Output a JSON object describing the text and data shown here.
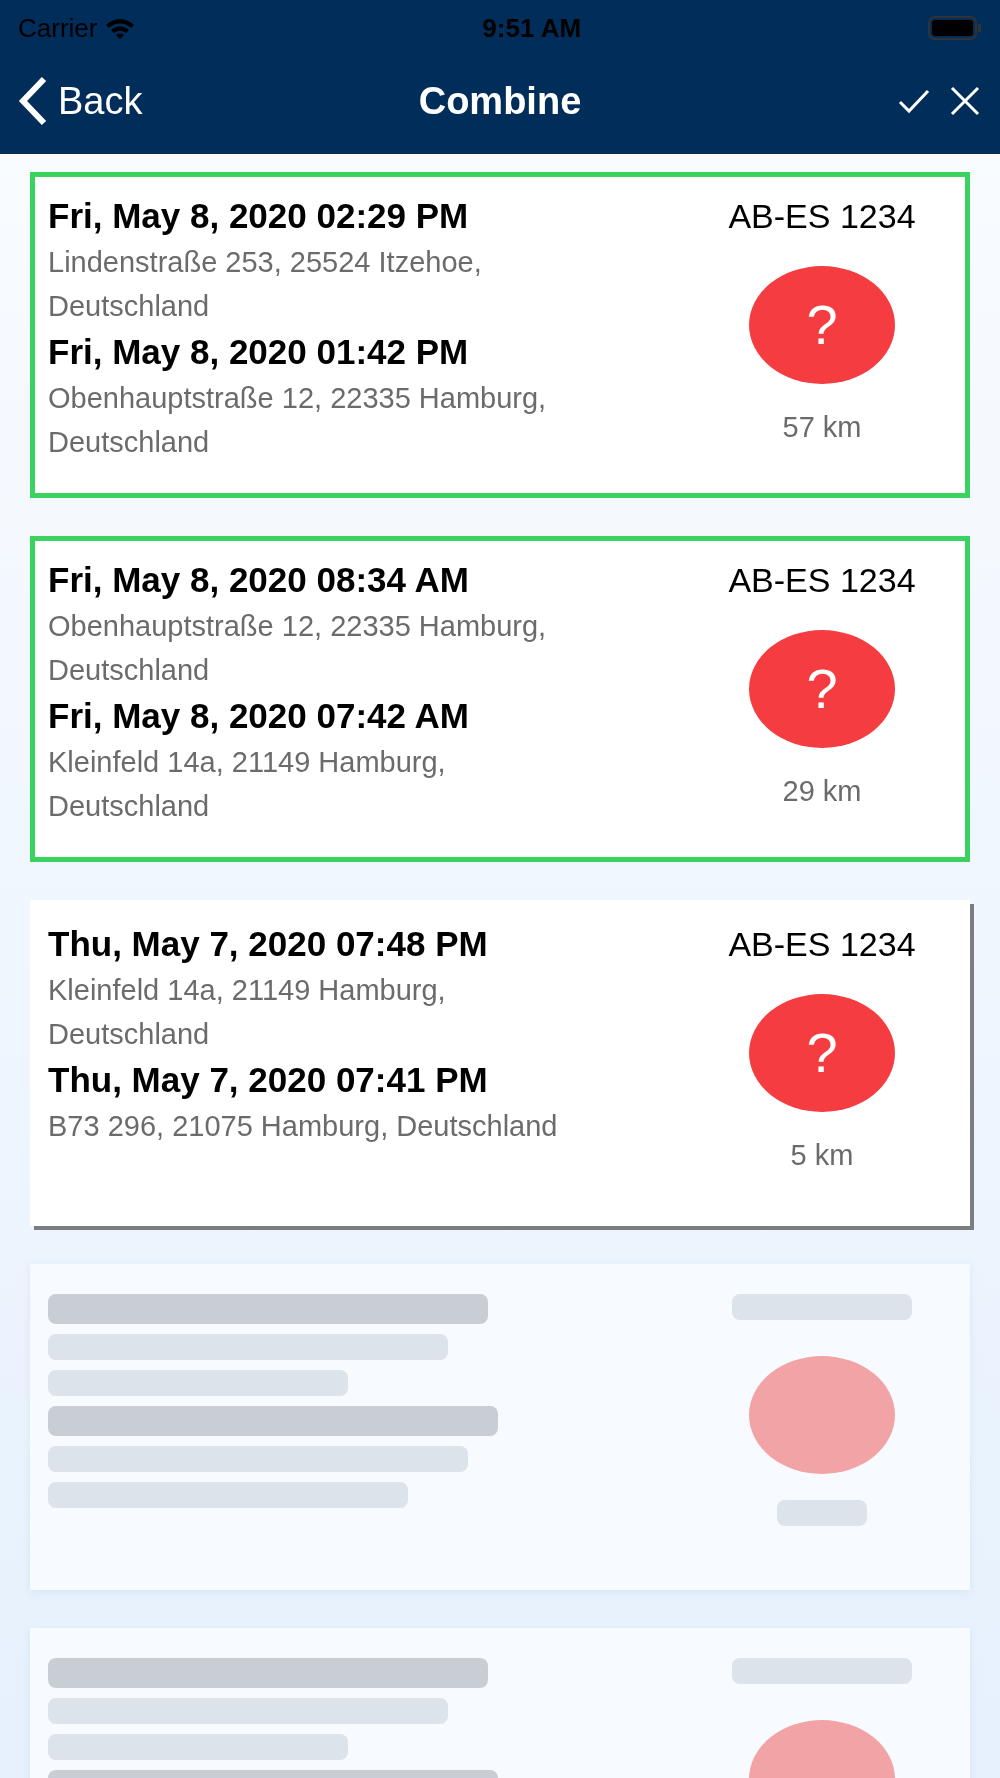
{
  "status_bar": {
    "carrier": "Carrier",
    "time": "9:51 AM"
  },
  "nav": {
    "back": "Back",
    "title": "Combine"
  },
  "trips": [
    {
      "selected": true,
      "blurred": false,
      "end_time": "Fri, May 8, 2020 02:29 PM",
      "end_address": "Lindenstraße 253, 25524 Itzehoe, Deutschland",
      "start_time": "Fri, May 8, 2020 01:42 PM",
      "start_address": "Obenhauptstraße 12, 22335 Hamburg, Deutschland",
      "plate": "AB-ES 1234",
      "badge": "?",
      "distance": "57 km"
    },
    {
      "selected": true,
      "blurred": false,
      "end_time": "Fri, May 8, 2020 08:34 AM",
      "end_address": "Obenhauptstraße 12, 22335 Hamburg, Deutschland",
      "start_time": "Fri, May 8, 2020 07:42 AM",
      "start_address": "Kleinfeld 14a, 21149 Hamburg, Deutschland",
      "plate": "AB-ES 1234",
      "badge": "?",
      "distance": "29 km"
    },
    {
      "selected": false,
      "blurred": false,
      "end_time": "Thu, May 7, 2020 07:48 PM",
      "end_address": "Kleinfeld 14a, 21149 Hamburg, Deutschland",
      "start_time": "Thu, May 7, 2020 07:41 PM",
      "start_address": "B73 296, 21075 Hamburg, Deutschland",
      "plate": "AB-ES 1234",
      "badge": "?",
      "distance": "5 km"
    },
    {
      "selected": false,
      "blurred": true
    },
    {
      "selected": false,
      "blurred": true
    }
  ]
}
